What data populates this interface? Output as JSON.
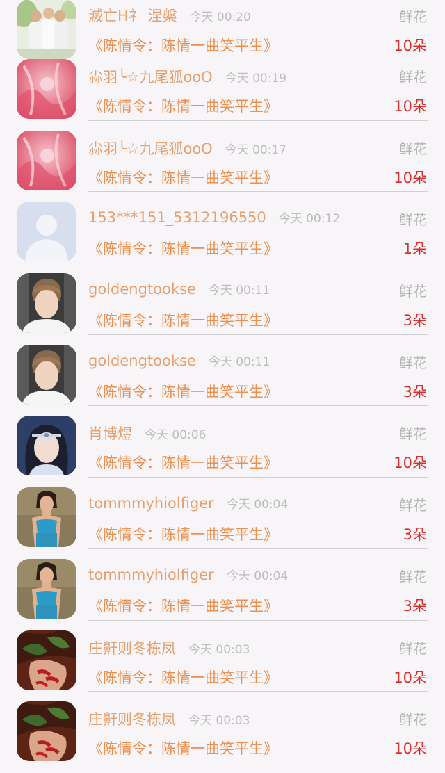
{
  "gift_list": [
    {
      "name": "滅亡H礻 涅槃",
      "time": "今天 00:20",
      "gift_type": "鲜花",
      "title": "《陈情令：陈情一曲笑平生》",
      "count": "10朵",
      "avatar": "group-photo"
    },
    {
      "name": "尛羽╰☆九尾狐ooO",
      "time": "今天 00:19",
      "gift_type": "鲜花",
      "title": "《陈情令：陈情一曲笑平生》",
      "count": "10朵",
      "avatar": "pink-anime"
    },
    {
      "name": "尛羽╰☆九尾狐ooO",
      "time": "今天 00:17",
      "gift_type": "鲜花",
      "title": "《陈情令：陈情一曲笑平生》",
      "count": "10朵",
      "avatar": "pink-anime"
    },
    {
      "name": "153***151_5312196550",
      "time": "今天 00:12",
      "gift_type": "鲜花",
      "title": "《陈情令：陈情一曲笑平生》",
      "count": "1朵",
      "avatar": "default-user"
    },
    {
      "name": "goldengtookse",
      "time": "今天 00:11",
      "gift_type": "鲜花",
      "title": "《陈情令：陈情一曲笑平生》",
      "count": "3朵",
      "avatar": "young-man"
    },
    {
      "name": "goldengtookse",
      "time": "今天 00:11",
      "gift_type": "鲜花",
      "title": "《陈情令：陈情一曲笑平生》",
      "count": "3朵",
      "avatar": "young-man"
    },
    {
      "name": "肖博煜",
      "time": "今天 00:06",
      "gift_type": "鲜花",
      "title": "《陈情令：陈情一曲笑平生》",
      "count": "10朵",
      "avatar": "costume-man"
    },
    {
      "name": "tommmyhiolfiger",
      "time": "今天 00:04",
      "gift_type": "鲜花",
      "title": "《陈情令：陈情一曲笑平生》",
      "count": "3朵",
      "avatar": "woman-blue"
    },
    {
      "name": "tommmyhiolfiger",
      "time": "今天 00:04",
      "gift_type": "鲜花",
      "title": "《陈情令：陈情一曲笑平生》",
      "count": "3朵",
      "avatar": "woman-blue"
    },
    {
      "name": "庄鼾则冬栋凤",
      "time": "今天 00:03",
      "gift_type": "鲜花",
      "title": "《陈情令：陈情一曲笑平生》",
      "count": "10朵",
      "avatar": "hand-leaf"
    },
    {
      "name": "庄鼾则冬栋凤",
      "time": "今天 00:03",
      "gift_type": "鲜花",
      "title": "《陈情令：陈情一曲笑平生》",
      "count": "10朵",
      "avatar": "hand-leaf"
    }
  ],
  "colors": {
    "name": "#e6a06d",
    "title": "#ec8f4f",
    "count": "#d9302e",
    "time": "#bdbdbd",
    "gift_type": "#b5b5b5",
    "background": "#f7f5f7"
  }
}
